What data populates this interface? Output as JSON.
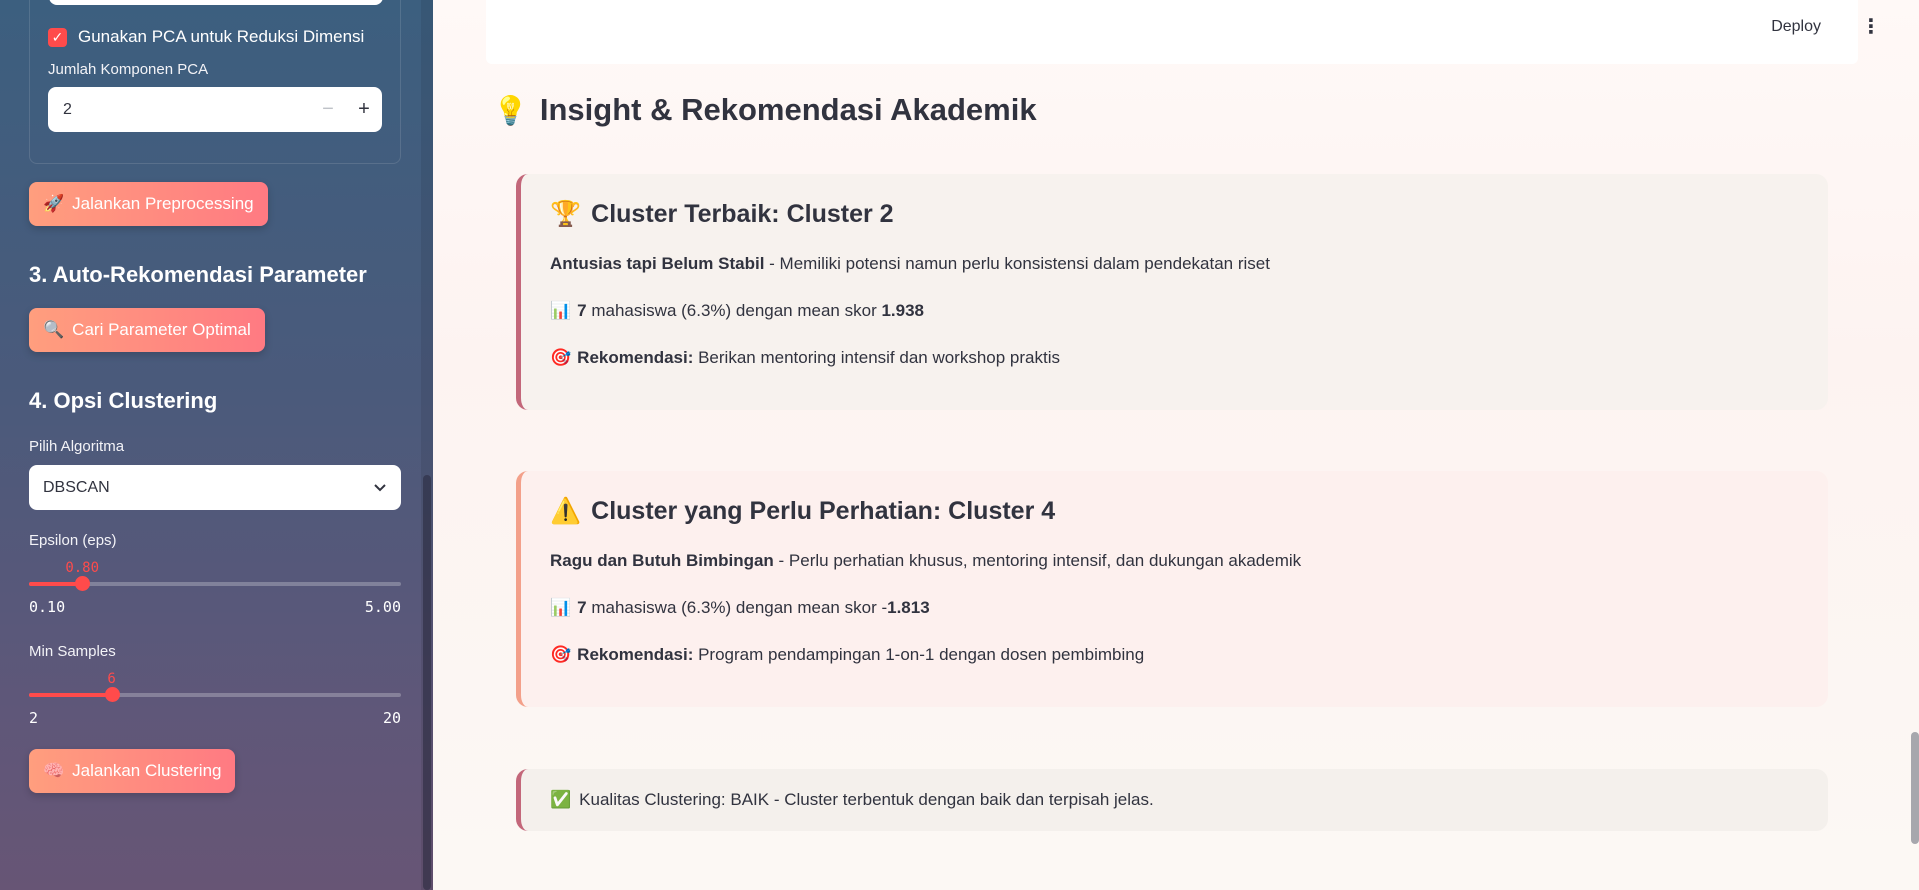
{
  "sidebar": {
    "pca_checkbox_label": "Gunakan PCA untuk Reduksi Dimensi",
    "pca_components_label": "Jumlah Komponen PCA",
    "pca_components_value": "2",
    "minus_symbol": "−",
    "plus_symbol": "+",
    "preprocess_button": "Jalankan Preprocessing",
    "preprocess_icon": "🚀",
    "section3_title": "3. Auto-Rekomendasi Parameter",
    "optimal_button": "Cari Parameter Optimal",
    "optimal_icon": "🔍",
    "section4_title": "4. Opsi Clustering",
    "algorithm_label": "Pilih Algoritma",
    "algorithm_value": "DBSCAN",
    "epsilon": {
      "label": "Epsilon (eps)",
      "value": "0.80",
      "min": "0.10",
      "max": "5.00",
      "fraction": 0.143
    },
    "min_samples": {
      "label": "Min Samples",
      "value": "6",
      "min": "2",
      "max": "20",
      "fraction": 0.222
    },
    "cluster_button": "Jalankan Clustering",
    "cluster_icon": "🧠"
  },
  "header": {
    "deploy": "Deploy",
    "menu_icon": "⋮"
  },
  "main": {
    "title_icon": "💡",
    "title": "Insight & Rekomendasi Akademik",
    "best": {
      "icon": "🏆",
      "title": "Cluster Terbaik: Cluster 2",
      "desc_bold": "Antusias tapi Belum Stabil",
      "desc_rest": " - Memiliki potensi namun perlu konsistensi dalam pendekatan riset",
      "stats_icon": "📊",
      "stats_count": "7",
      "stats_mid": " mahasiswa (6.3%) dengan mean skor ",
      "stats_score": "1.938",
      "rec_icon": "🎯",
      "rec_label": "Rekomendasi:",
      "rec_text": " Berikan mentoring intensif dan workshop praktis"
    },
    "warn": {
      "icon": "⚠️",
      "title": "Cluster yang Perlu Perhatian: Cluster 4",
      "desc_bold": "Ragu dan Butuh Bimbingan",
      "desc_rest": " - Perlu perhatian khusus, mentoring intensif, dan dukungan akademik",
      "stats_icon": "📊",
      "stats_count": "7",
      "stats_mid": " mahasiswa (6.3%) dengan mean skor -",
      "stats_score": "1.813",
      "rec_icon": "🎯",
      "rec_label": "Rekomendasi:",
      "rec_text": " Program pendampingan 1-on-1 dengan dosen pembimbing"
    },
    "quality": {
      "icon": "✅",
      "text": "Kualitas Clustering: BAIK - Cluster terbentuk dengan baik dan terpisah jelas."
    }
  }
}
